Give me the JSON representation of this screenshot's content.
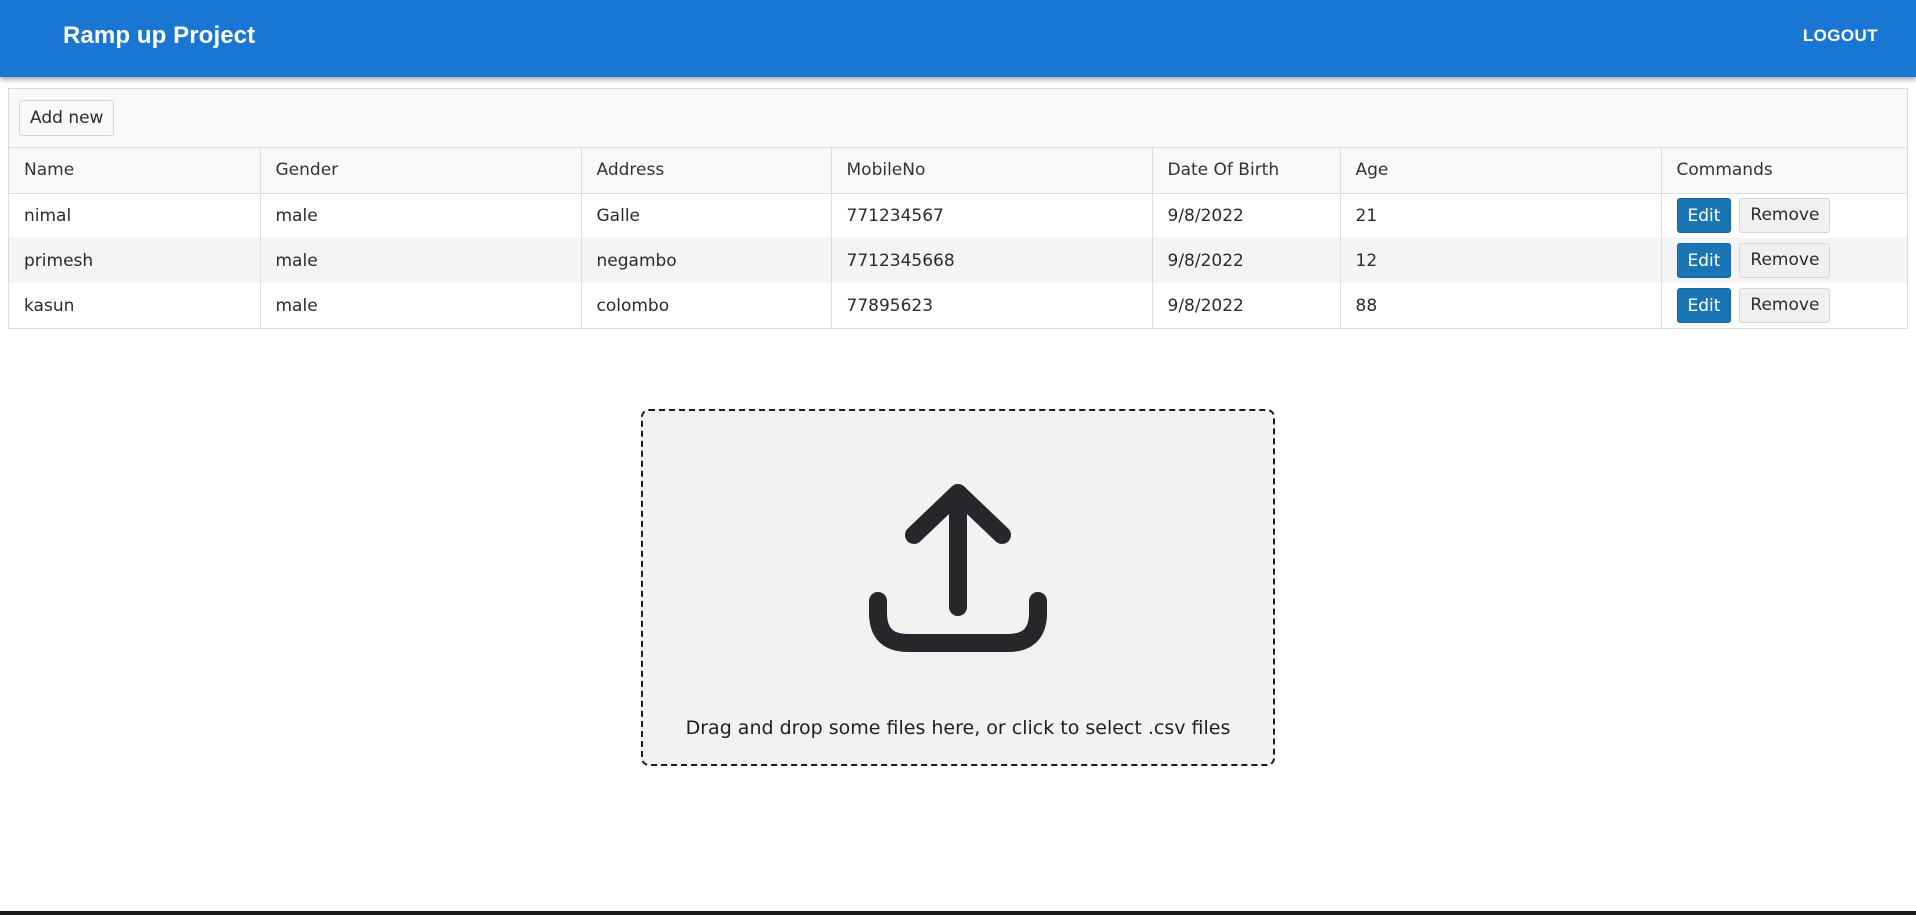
{
  "appbar": {
    "title": "Ramp up Project",
    "logout_label": "LOGOUT",
    "color": "#1976d2"
  },
  "grid": {
    "add_new_label": "Add new",
    "columns": [
      "Name",
      "Gender",
      "Address",
      "MobileNo",
      "Date Of Birth",
      "Age",
      "Commands"
    ],
    "rows": [
      {
        "name": "nimal",
        "gender": "male",
        "address": "Galle",
        "mobile": "771234567",
        "dob": "9/8/2022",
        "age": "21"
      },
      {
        "name": "primesh",
        "gender": "male",
        "address": "negambo",
        "mobile": "7712345668",
        "dob": "9/8/2022",
        "age": "12"
      },
      {
        "name": "kasun",
        "gender": "male",
        "address": "colombo",
        "mobile": "77895623",
        "dob": "9/8/2022",
        "age": "88"
      }
    ],
    "edit_label": "Edit",
    "remove_label": "Remove",
    "edit_color": "#1a75b5"
  },
  "dropzone": {
    "icon": "upload-icon",
    "text": "Drag and drop some files here, or click to select .csv files"
  }
}
